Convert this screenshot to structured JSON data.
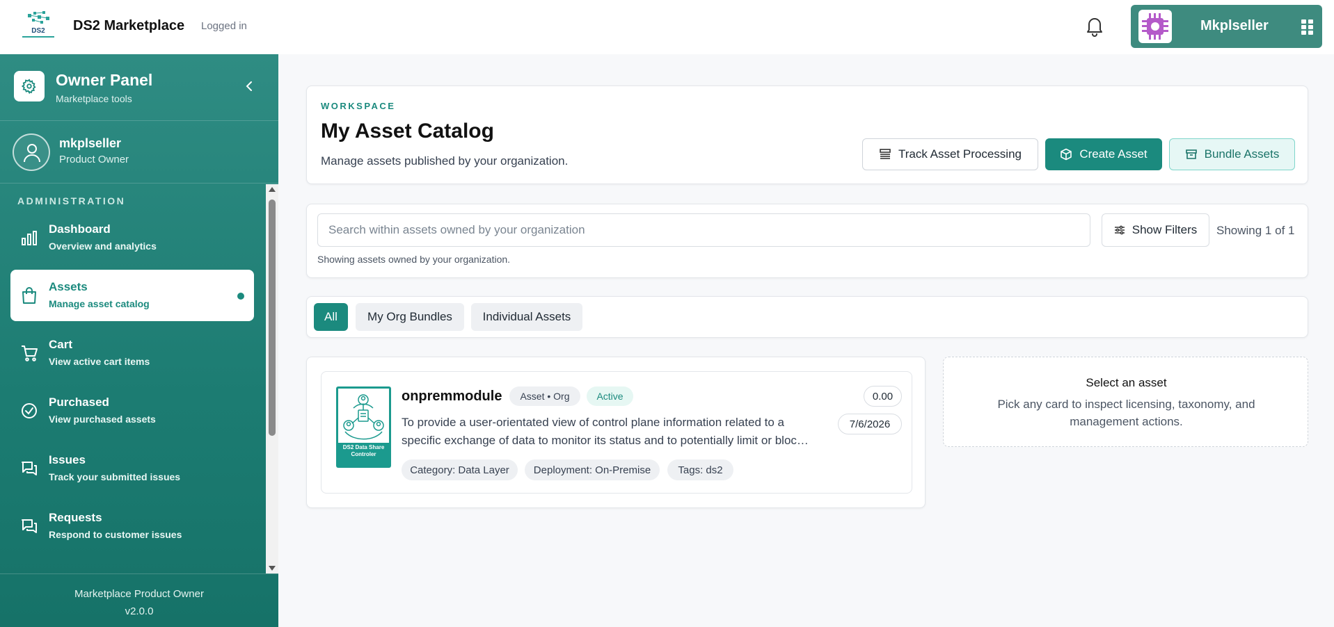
{
  "header": {
    "brand": "DS2 Marketplace",
    "status": "Logged in",
    "logo_text": "DS2",
    "user_name": "Mkplseller"
  },
  "sidebar": {
    "title": "Owner Panel",
    "subtitle": "Marketplace tools",
    "profile_name": "mkplseller",
    "profile_role": "Product Owner",
    "section": "ADMINISTRATION",
    "items": [
      {
        "title": "Dashboard",
        "sub": "Overview and analytics",
        "icon": "bar-chart-icon",
        "active": false
      },
      {
        "title": "Assets",
        "sub": "Manage asset catalog",
        "icon": "shopping-bag-icon",
        "active": true
      },
      {
        "title": "Cart",
        "sub": "View active cart items",
        "icon": "cart-icon",
        "active": false
      },
      {
        "title": "Purchased",
        "sub": "View purchased assets",
        "icon": "check-circle-icon",
        "active": false
      },
      {
        "title": "Issues",
        "sub": "Track your submitted issues",
        "icon": "chat-icon",
        "active": false
      },
      {
        "title": "Requests",
        "sub": "Respond to customer issues",
        "icon": "chat-icon",
        "active": false
      }
    ],
    "footer_title": "Marketplace Product Owner",
    "footer_version": "v2.0.0"
  },
  "workspace": {
    "label": "WORKSPACE",
    "title": "My Asset Catalog",
    "description": "Manage assets published by your organization.",
    "buttons": {
      "track": "Track Asset Processing",
      "create": "Create Asset",
      "bundle": "Bundle Assets"
    }
  },
  "search": {
    "placeholder": "Search within assets owned by your organization",
    "value": "",
    "filters_label": "Show Filters",
    "count": "Showing 1 of 1",
    "hint": "Showing assets owned by your organization."
  },
  "tabs": [
    "All",
    "My Org Bundles",
    "Individual Assets"
  ],
  "asset": {
    "name": "onpremmodule",
    "type_badge": "Asset • Org",
    "status_badge": "Active",
    "price": "0.00",
    "date": "7/6/2026",
    "description": "To provide a user-orientated view of control plane information related to a specific exchange of data to monitor its status and to potentially limit or bloc…",
    "thumb_title": "DS2 Data Share Controler",
    "tags": [
      "Category: Data Layer",
      "Deployment: On-Premise",
      "Tags: ds2"
    ]
  },
  "detail": {
    "title": "Select an asset",
    "description": "Pick any card to inspect licensing, taxonomy, and management actions."
  },
  "colors": {
    "accent": "#1b8a7e",
    "sidebar": "#1c7c72",
    "user_chip": "#3e8b7f"
  }
}
